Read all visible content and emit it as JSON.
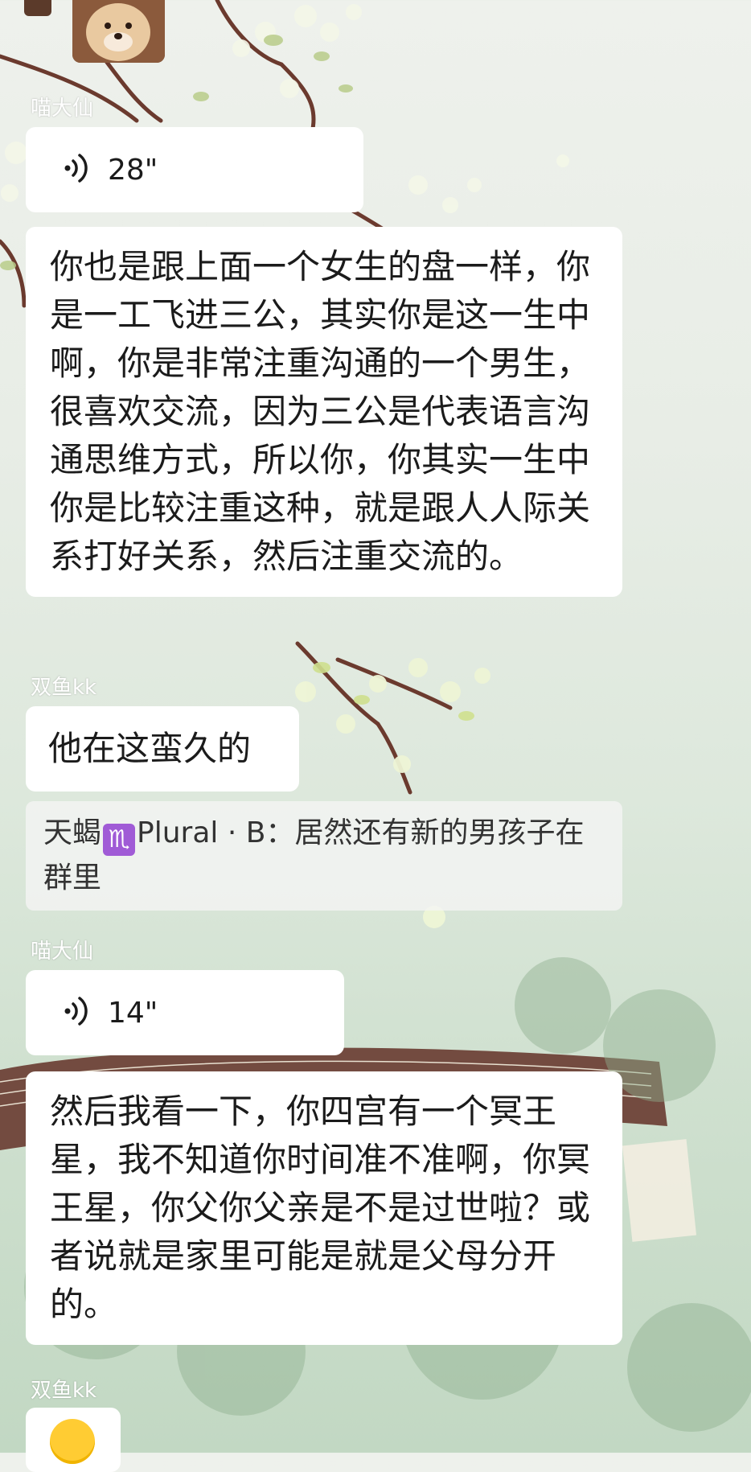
{
  "messages": [
    {
      "sender": "喵大仙",
      "type": "voice",
      "duration": "28\""
    },
    {
      "type": "text",
      "text": "你也是跟上面一个女生的盘一样，你是一工飞进三公，其实你是这一生中啊，你是非常注重沟通的一个男生，很喜欢交流，因为三公是代表语言沟通思维方式，所以你，你其实一生中你是比较注重这种，就是跟人人际关系打好关系，然后注重交流的。"
    },
    {
      "sender": "双鱼kk",
      "type": "text",
      "text": "他在这蛮久的"
    },
    {
      "type": "quote",
      "quote_sender": "天蝎",
      "quote_emoji": "♏",
      "quote_sender_suffix": "Plural · B：",
      "quote_text": "居然还有新的男孩子在群里"
    },
    {
      "sender": "喵大仙",
      "type": "voice",
      "duration": "14\""
    },
    {
      "type": "text",
      "text": "然后我看一下，你四宫有一个冥王星，我不知道你时间准不准啊，你冥王星，你父你父亲是不是过世啦？或者说就是家里可能是就是父母分开的。"
    },
    {
      "sender": "双鱼kk",
      "type": "emoji"
    }
  ],
  "icons": {
    "voice": "voice-wave-icon",
    "avatar": "dog-avatar-icon",
    "zodiac": "scorpio-emoji-icon",
    "emoji": "grin-emoji-icon"
  },
  "colors": {
    "bubble": "#ffffff",
    "sender_name": "#ffffff",
    "zodiac": "#a05bd6"
  }
}
